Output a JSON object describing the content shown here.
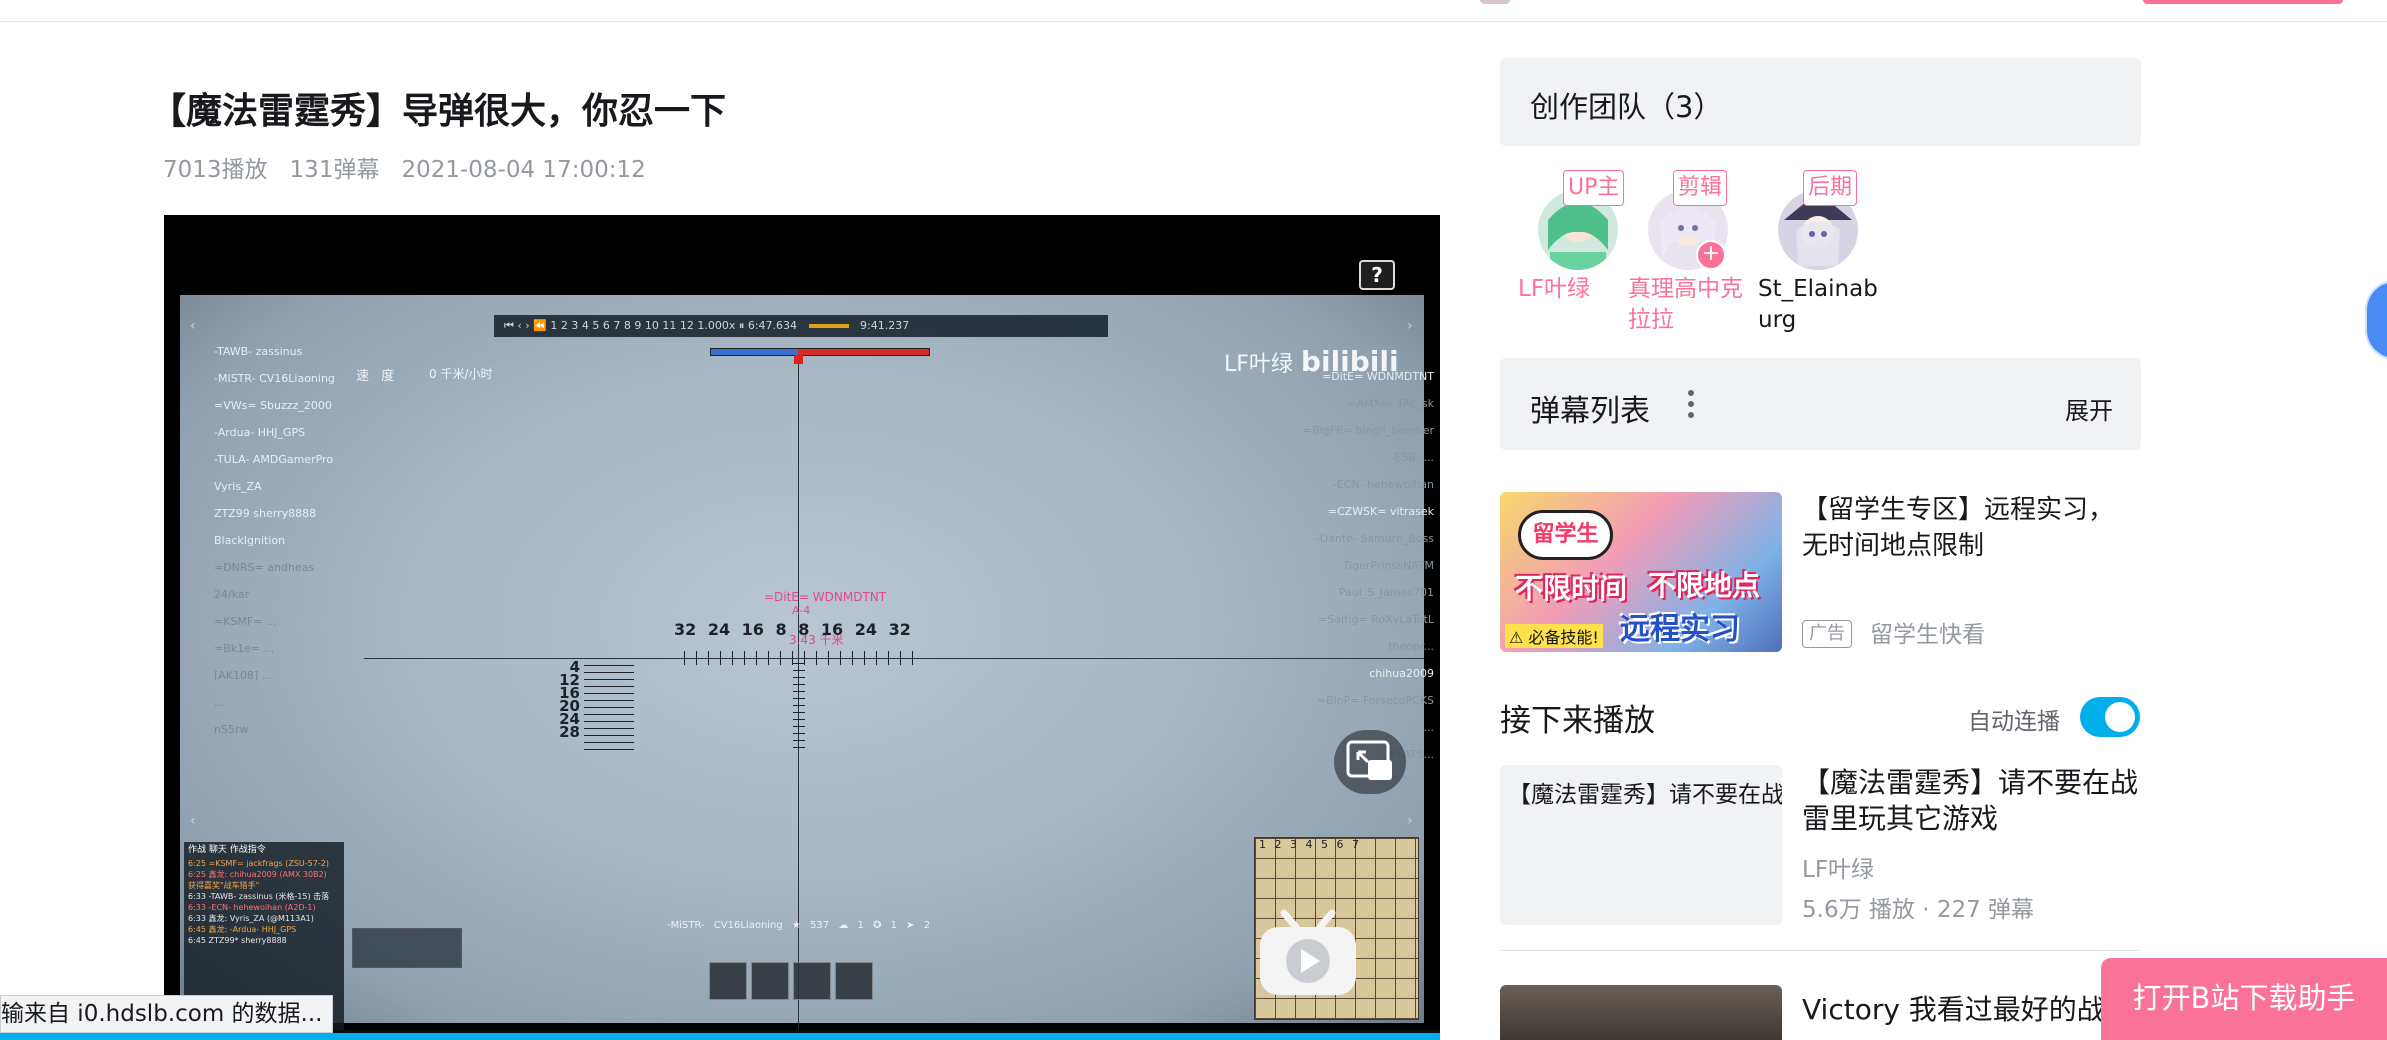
{
  "video": {
    "title": "【魔法雷霆秀】导弹很大，你忍一下",
    "plays": "7013播放",
    "danmaku_count": "131弹幕",
    "datetime": "2021-08-04 17:00:12"
  },
  "player": {
    "help_glyph": "?",
    "watermark_user": "LF叶绿",
    "watermark_brand": "bilibili",
    "speed_label": "速 度",
    "speed_value": "0 千米/小时",
    "replay_start": "6:47.634",
    "replay_end": "9:41.237",
    "replay_zoom": "1.000x",
    "target_name": "=DitE= WDNMDTNT",
    "target_type": "A-4",
    "target_range": "3.43 千米",
    "mil_scale": "32 24 16 8 8 16 24 32",
    "range_scale": [
      "4",
      "12",
      "16",
      "20",
      "24",
      "28"
    ],
    "left_players": [
      "-TAWB- zassinus",
      "-MISTR- CV16Liaoning",
      "=VWs= Sbuzzz_2000",
      "-Ardua- HHJ_GPS",
      "-TULA- AMDGamerPro",
      "Vyris_ZA",
      "ZTZ99 sherry8888",
      "BlackIgnition",
      "=DNRS= andheas",
      "24/kar",
      "=KSMF= ...",
      "=Bk1e= ...",
      "[AK108] ...",
      "...",
      "nS5rw"
    ],
    "right_players": [
      "=DitE= WDNMDTNT",
      "=AMXI= TAL_sk",
      "=BigFE= bingli_bomber",
      "-ESB- ...",
      "-ECN- hehewoihan",
      "=CZWSK= vitrasek",
      "-Dante- Samuro_Boss",
      "TigerPrinssNATM",
      "Paul_S_James701",
      "=Saltig= RoXyLaTotL",
      "theopr...",
      "chihua2009",
      "=BlnP= ForsecoPCKS",
      "...",
      "JKLAT5..."
    ],
    "chat_header": "作战  聊天  作战指令",
    "chat_lines": [
      "6:25 =KSMF= jackfrags (ZSU-57-2)",
      "6:25 鑫龙: chihua2009 (AMX 30B2)",
      "获得嘉奖\"战车猎手\"",
      "6:33 -TAWB- zassinus (米格-15) 击落",
      "6:33 -ECN- hehewoihan (A2D-1)",
      "6:33 鑫龙: Vyris_ZA (@M113A1)",
      "6:45 鑫龙: -Ardua- HHJ_GPS",
      "6:45 ZTZ99* sherry8888"
    ],
    "player_line": "-MiSTR- CV16Liaoning  ★ 537  ☁ 1  ✪ 1  ➤ 2",
    "minimap_cols": "1 2 3 4 5 6 7"
  },
  "status_tip": "输来自 i0.hdslb.com 的数据...",
  "team": {
    "title": "创作团队（3）",
    "members": [
      {
        "role": "UP主",
        "name": "LF叶绿",
        "name_color": "#fb7299"
      },
      {
        "role": "剪辑",
        "name": "真理高中克拉拉",
        "name_color": "#fb7299"
      },
      {
        "role": "后期",
        "name": "St_Elainaburg",
        "name_color": "#18191c"
      }
    ]
  },
  "danmaku_list": {
    "title": "弹幕列表",
    "expand": "展开"
  },
  "ad": {
    "title": "【留学生专区】远程实习，无时间地点限制",
    "badge": "广告",
    "source": "留学生快看",
    "thumb_bubble": "留学生",
    "thumb_text1": "不限时间",
    "thumb_text2": "不限地点",
    "thumb_text3": "远程实习",
    "thumb_warn": "⚠ 必备技能!"
  },
  "up_next": {
    "title": "接下来播放",
    "autoplay_label": "自动连播",
    "autoplay_on": true
  },
  "recommendations": [
    {
      "thumb_text": "【魔法雷霆秀】请不要在战",
      "title": "【魔法雷霆秀】请不要在战雷里玩其它游戏",
      "author": "LF叶绿",
      "stats": "5.6万 播放 · 227 弹幕"
    },
    {
      "title": "Victory 我看过最好的战争"
    }
  ],
  "download_button": "打开B站下载助手",
  "colors": {
    "accent_pink": "#fb7299",
    "accent_blue": "#00aeec",
    "text_main": "#18191c",
    "text_muted": "#9499a0",
    "panel_bg": "#f1f2f3"
  }
}
